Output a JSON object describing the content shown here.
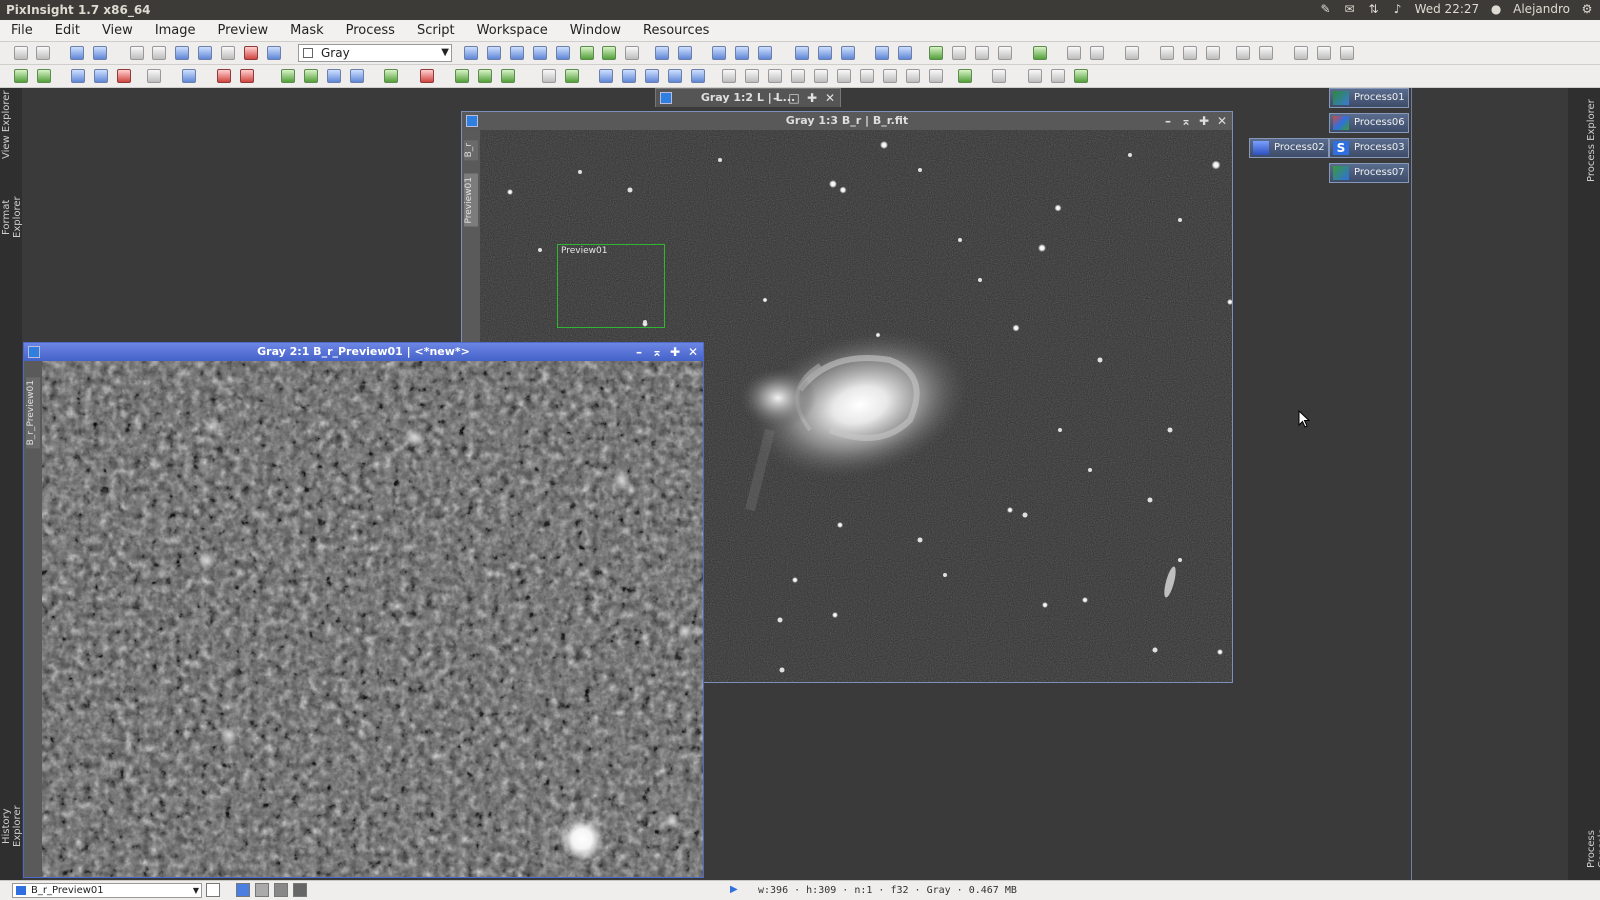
{
  "system_bar": {
    "app_title": "PixInsight 1.7 x86_64",
    "clock": "Wed 22:27",
    "user": "Alejandro"
  },
  "menu": [
    "File",
    "Edit",
    "View",
    "Image",
    "Preview",
    "Mask",
    "Process",
    "Script",
    "Workspace",
    "Window",
    "Resources"
  ],
  "toolbar": {
    "view_selector_value": "Gray"
  },
  "left_explorers": [
    "View Explorer",
    "Format Explorer",
    "History Explorer"
  ],
  "right_explorers": [
    "Process Explorer",
    "Process Console"
  ],
  "windows": {
    "main": {
      "title": "Gray 1:3 B_r | B_r.fit",
      "tabs": [
        "B_r",
        "Preview01"
      ],
      "preview_label": "Preview01"
    },
    "preview": {
      "title": "Gray 2:1 B_r_Preview01 | <*new*>",
      "tab": "B_r_Preview01"
    },
    "minimized": {
      "title": "Gray 1:2 L | L..."
    }
  },
  "process_icons": [
    "Process01",
    "Process06",
    "Process02",
    "Process03",
    "Process07"
  ],
  "status": {
    "view": "B_r_Preview01",
    "info": "w:396 · h:309 · n:1 · f32 · Gray · 0.467 MB"
  }
}
